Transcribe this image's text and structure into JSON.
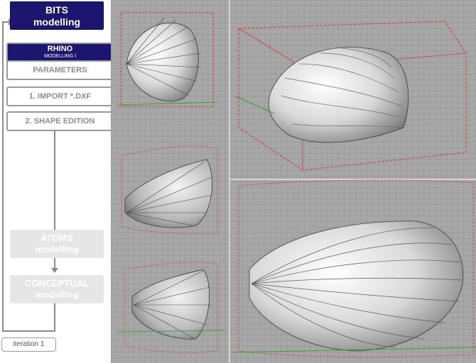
{
  "sidebar": {
    "bits_button": {
      "line1": "BITS",
      "line2": "modelling"
    },
    "rhino_button": {
      "line1": "RHINO",
      "line2": "MODELLING I"
    },
    "parameters_button": "PARAMETERS",
    "import_button": "1. IMPORT *.DXF",
    "shape_edition_button": "2. SHAPE EDITION",
    "atoms_button": {
      "line1": "ATOMS",
      "line2": "modelling"
    },
    "conceptual_button": {
      "line1": "CONCEPTUAL",
      "line2": "modelling"
    },
    "iteration_label": "iteration  1"
  },
  "viewport": {
    "panels": [
      "top-left-view",
      "perspective-view",
      "mid-left-view",
      "bottom-left-view",
      "large-side-view"
    ]
  }
}
